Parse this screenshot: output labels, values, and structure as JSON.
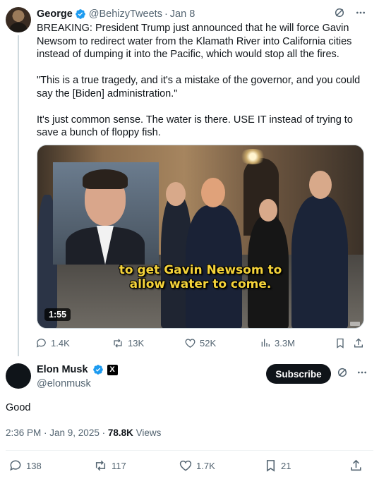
{
  "quoted_tweet": {
    "author_name": "George",
    "handle": "@BehizyTweets",
    "separator": "·",
    "date": "Jan 8",
    "paragraphs": [
      "BREAKING: President Trump just announced that he will force Gavin Newsom to redirect water from the Klamath River into California cities instead of dumping it into the Pacific, which would stop all the fires.",
      "\"This is a true tragedy, and it's a mistake of the governor, and you could say the [Biden] administration.\"",
      "It's just common sense. The water is there. USE IT instead of trying to save a bunch of floppy fish."
    ],
    "video": {
      "caption_line1": "to get Gavin Newsom to",
      "caption_line2": "allow water to come.",
      "duration": "1:55"
    },
    "metrics": {
      "replies": "1.4K",
      "reposts": "13K",
      "likes": "52K",
      "views": "3.3M"
    }
  },
  "reply_tweet": {
    "author_name": "Elon Musk",
    "handle": "@elonmusk",
    "x_badge": "X",
    "subscribe_label": "Subscribe",
    "text": "Good",
    "timestamp": "2:36 PM · Jan 9, 2025 · ",
    "views_count": "78.8K",
    "views_label": " Views",
    "metrics": {
      "replies": "138",
      "reposts": "117",
      "likes": "1.7K",
      "bookmarks": "21"
    }
  },
  "colors": {
    "verified_blue": "#1d9bf0",
    "text_primary": "#0f1419",
    "text_secondary": "#536471",
    "caption_yellow": "#f5d33a"
  }
}
